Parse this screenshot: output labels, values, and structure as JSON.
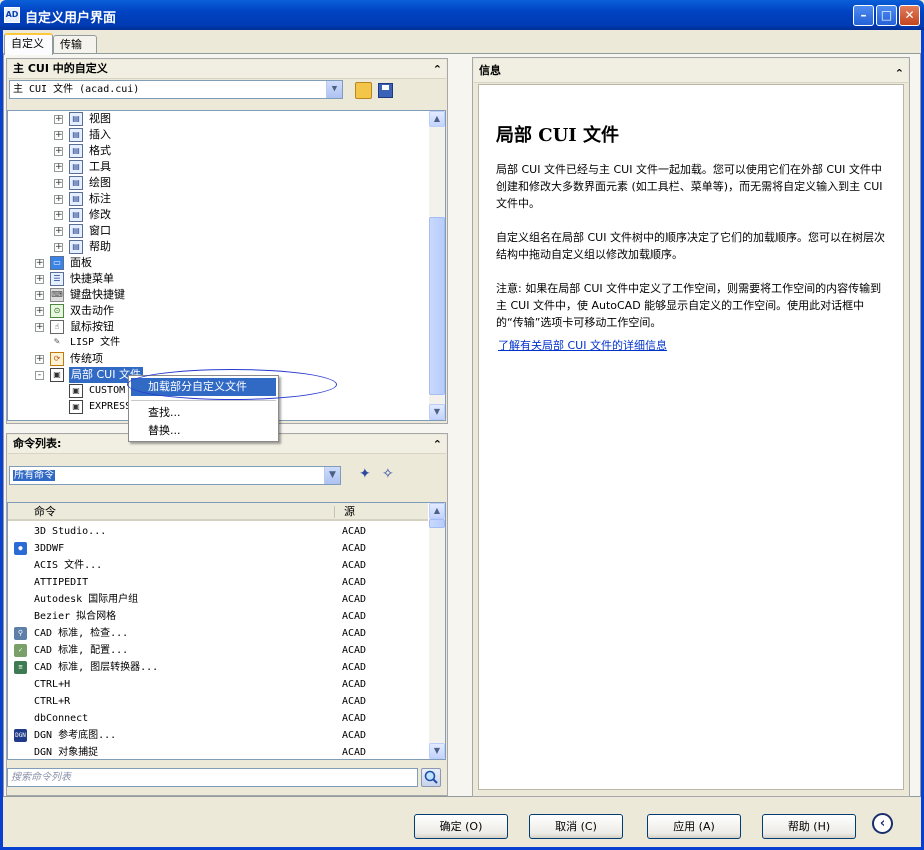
{
  "window": {
    "title": "自定义用户界面",
    "app_icon": "autocad-icon"
  },
  "tabs": [
    {
      "label": "自定义",
      "active": true
    },
    {
      "label": "传输",
      "active": false
    }
  ],
  "left_panel": {
    "title": "主 CUI 中的自定义",
    "file_combo": "主 CUI 文件 (acad.cui)",
    "tree": [
      {
        "label": "视图",
        "level": 2,
        "expander": "+",
        "icon": "toolbar-icon"
      },
      {
        "label": "插入",
        "level": 2,
        "expander": "+",
        "icon": "toolbar-icon"
      },
      {
        "label": "格式",
        "level": 2,
        "expander": "+",
        "icon": "toolbar-icon"
      },
      {
        "label": "工具",
        "level": 2,
        "expander": "+",
        "icon": "toolbar-icon"
      },
      {
        "label": "绘图",
        "level": 2,
        "expander": "+",
        "icon": "toolbar-icon"
      },
      {
        "label": "标注",
        "level": 2,
        "expander": "+",
        "icon": "toolbar-icon"
      },
      {
        "label": "修改",
        "level": 2,
        "expander": "+",
        "icon": "toolbar-icon"
      },
      {
        "label": "窗口",
        "level": 2,
        "expander": "+",
        "icon": "toolbar-icon"
      },
      {
        "label": "帮助",
        "level": 2,
        "expander": "+",
        "icon": "toolbar-icon"
      },
      {
        "label": "面板",
        "level": 1,
        "expander": "+",
        "icon": "panel-icon"
      },
      {
        "label": "快捷菜单",
        "level": 1,
        "expander": "+",
        "icon": "shortcut-menu-icon"
      },
      {
        "label": "键盘快捷键",
        "level": 1,
        "expander": "+",
        "icon": "keyboard-icon"
      },
      {
        "label": "双击动作",
        "level": 1,
        "expander": "+",
        "icon": "double-click-icon"
      },
      {
        "label": "鼠标按钮",
        "level": 1,
        "expander": "+",
        "icon": "mouse-icon"
      },
      {
        "label": "LISP 文件",
        "level": 1,
        "expander": "",
        "icon": "lisp-icon"
      },
      {
        "label": "传统项",
        "level": 1,
        "expander": "+",
        "icon": "legacy-icon"
      },
      {
        "label": "局部 CUI 文件",
        "level": 1,
        "expander": "-",
        "icon": "partial-cui-icon",
        "selected": true
      },
      {
        "label": "CUSTOM",
        "level": 2,
        "expander": "",
        "icon": "cui-file-icon"
      },
      {
        "label": "EXPRESS",
        "level": 2,
        "expander": "",
        "icon": "cui-file-icon"
      }
    ],
    "context_menu": [
      {
        "label": "加载部分自定义文件",
        "highlighted": true
      },
      {
        "label": "查找...",
        "highlighted": false
      },
      {
        "label": "替换...",
        "highlighted": false
      }
    ]
  },
  "commands_panel": {
    "title": "命令列表:",
    "filter_combo": "所有命令",
    "columns": [
      "命令",
      "源"
    ],
    "rows": [
      {
        "command": "3D Studio...",
        "source": "ACAD",
        "icon": ""
      },
      {
        "command": "3DDWF",
        "source": "ACAD",
        "icon": "3ddwf-icon"
      },
      {
        "command": "ACIS 文件...",
        "source": "ACAD",
        "icon": ""
      },
      {
        "command": "ATTIPEDIT",
        "source": "ACAD",
        "icon": ""
      },
      {
        "command": "Autodesk 国际用户组",
        "source": "ACAD",
        "icon": ""
      },
      {
        "command": "Bezier 拟合网格",
        "source": "ACAD",
        "icon": ""
      },
      {
        "command": "CAD 标准, 检查...",
        "source": "ACAD",
        "icon": "cad-check-icon"
      },
      {
        "command": "CAD 标准, 配置...",
        "source": "ACAD",
        "icon": "cad-config-icon"
      },
      {
        "command": "CAD 标准, 图层转换器...",
        "source": "ACAD",
        "icon": "layer-translator-icon"
      },
      {
        "command": "CTRL+H",
        "source": "ACAD",
        "icon": ""
      },
      {
        "command": "CTRL+R",
        "source": "ACAD",
        "icon": ""
      },
      {
        "command": "dbConnect",
        "source": "ACAD",
        "icon": ""
      },
      {
        "command": "DGN 参考底图...",
        "source": "ACAD",
        "icon": "dgn-icon"
      },
      {
        "command": "DGN 对象捕捉",
        "source": "ACAD",
        "icon": ""
      }
    ],
    "search_placeholder": "搜索命令列表"
  },
  "info_panel": {
    "title": "信息",
    "heading": "局部 CUI 文件",
    "paragraphs": [
      "局部 CUI 文件已经与主 CUI 文件一起加载。您可以使用它们在外部 CUI 文件中创建和修改大多数界面元素 (如工具栏、菜单等)，而无需将自定义输入到主 CUI 文件中。",
      "自定义组名在局部 CUI 文件树中的顺序决定了它们的加载顺序。您可以在树层次结构中拖动自定义组以修改加载顺序。",
      "注意: 如果在局部 CUI 文件中定义了工作空间，则需要将工作空间的内容传输到主 CUI 文件中，使 AutoCAD 能够显示自定义的工作空间。使用此对话框中的“传输”选项卡可移动工作空间。"
    ],
    "link": "了解有关局部 CUI 文件的详细信息"
  },
  "buttons": {
    "ok": "确定 (O)",
    "cancel": "取消 (C)",
    "apply": "应用 (A)",
    "help": "帮助 (H)"
  }
}
